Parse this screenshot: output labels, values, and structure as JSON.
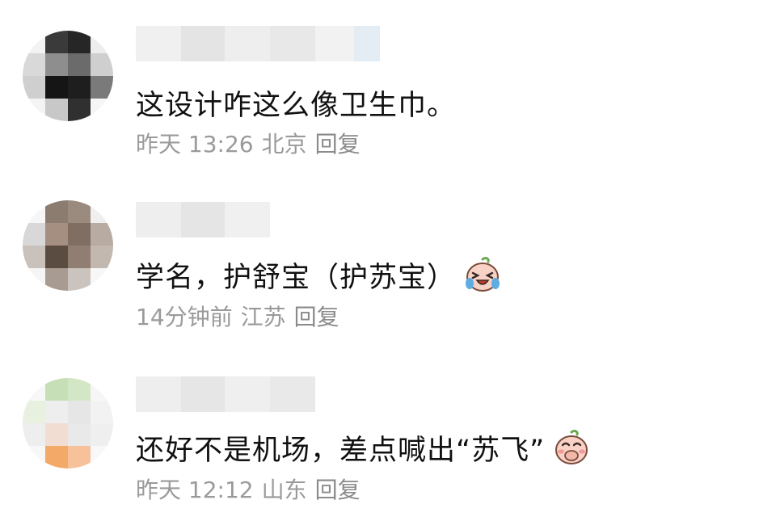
{
  "comments": [
    {
      "text": "这设计咋这么像卫生巾。",
      "time": "昨天 13:26",
      "location": "北京",
      "reply": "回复",
      "emoji": null
    },
    {
      "text": "学名，护舒宝（护苏宝）",
      "time": "14分钟前",
      "location": "江苏",
      "reply": "回复",
      "emoji": "crying-laughing-face-icon"
    },
    {
      "text": "还好不是机场，差点喊出“苏飞”",
      "time": "昨天 12:12",
      "location": "山东",
      "reply": "回复",
      "emoji": "covering-mouth-laughing-face-icon"
    }
  ]
}
